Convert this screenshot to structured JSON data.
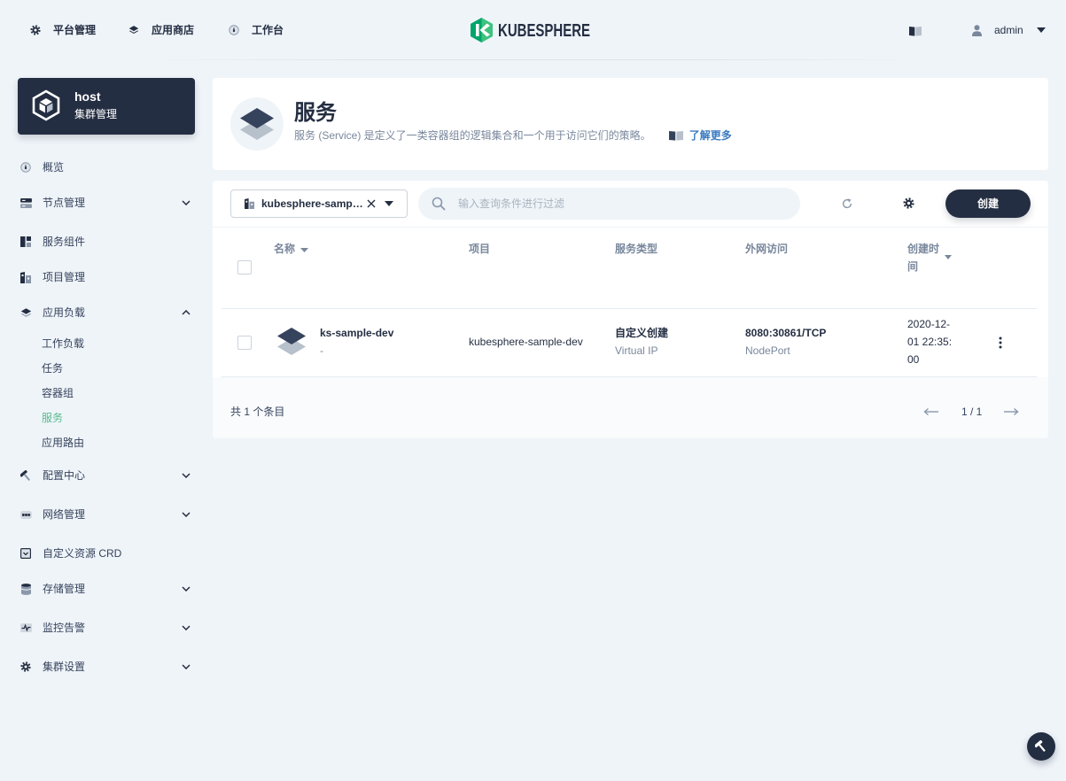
{
  "topnav": {
    "items": [
      {
        "label": "平台管理",
        "icon": "gear-icon"
      },
      {
        "label": "应用商店",
        "icon": "appstore-icon"
      },
      {
        "label": "工作台",
        "icon": "dashboard-icon"
      }
    ],
    "logo_text": "KUBESPHERE",
    "user_name": "admin"
  },
  "sidebar": {
    "cluster": {
      "name": "host",
      "subtitle": "集群管理",
      "icon": "cluster-icon"
    },
    "items": [
      {
        "label": "概览",
        "icon": "dashboard-icon"
      },
      {
        "label": "节点管理",
        "icon": "nodes-icon",
        "expanded": false
      },
      {
        "label": "服务组件",
        "icon": "components-icon"
      },
      {
        "label": "项目管理",
        "icon": "project-icon"
      },
      {
        "label": "应用负载",
        "icon": "appstore-icon",
        "expanded": true,
        "children": [
          {
            "label": "工作负载"
          },
          {
            "label": "任务"
          },
          {
            "label": "容器组"
          },
          {
            "label": "服务",
            "active": true
          },
          {
            "label": "应用路由"
          }
        ]
      },
      {
        "label": "配置中心",
        "icon": "hammer-icon",
        "expanded": false
      },
      {
        "label": "网络管理",
        "icon": "network-icon",
        "expanded": false
      },
      {
        "label": "自定义资源 CRD",
        "icon": "crd-icon"
      },
      {
        "label": "存储管理",
        "icon": "storage-icon",
        "expanded": false
      },
      {
        "label": "监控告警",
        "icon": "monitor-icon",
        "expanded": false
      },
      {
        "label": "集群设置",
        "icon": "gear-icon",
        "expanded": false
      }
    ]
  },
  "page": {
    "title": "服务",
    "description": "服务 (Service) 是定义了一类容器组的逻辑集合和一个用于访问它们的策略。",
    "learn_more": "了解更多",
    "icon": "service-icon"
  },
  "toolbar": {
    "project_filter": "kubesphere-samp…",
    "search_placeholder": "输入查询条件进行过滤",
    "create_label": "创建"
  },
  "table": {
    "columns": {
      "name": "名称",
      "project": "项目",
      "type": "服务类型",
      "access": "外网访问",
      "created": "创建时间"
    },
    "rows": [
      {
        "name": "ks-sample-dev",
        "description": "-",
        "project": "kubesphere-sample-dev",
        "type": "自定义创建",
        "type_sub": "Virtual IP",
        "access": "8080:30861/TCP",
        "access_sub": "NodePort",
        "created": "2020-12-01 22:35:00"
      }
    ]
  },
  "footer": {
    "total": "共 1 个条目",
    "page": "1 / 1"
  },
  "colors": {
    "primary_dark": "#242e42",
    "active_green": "#55bc8a",
    "link_blue": "#3a7cc2",
    "text_secondary": "#79879c",
    "background": "#eff4f9",
    "logo_green": "#00aa72"
  }
}
